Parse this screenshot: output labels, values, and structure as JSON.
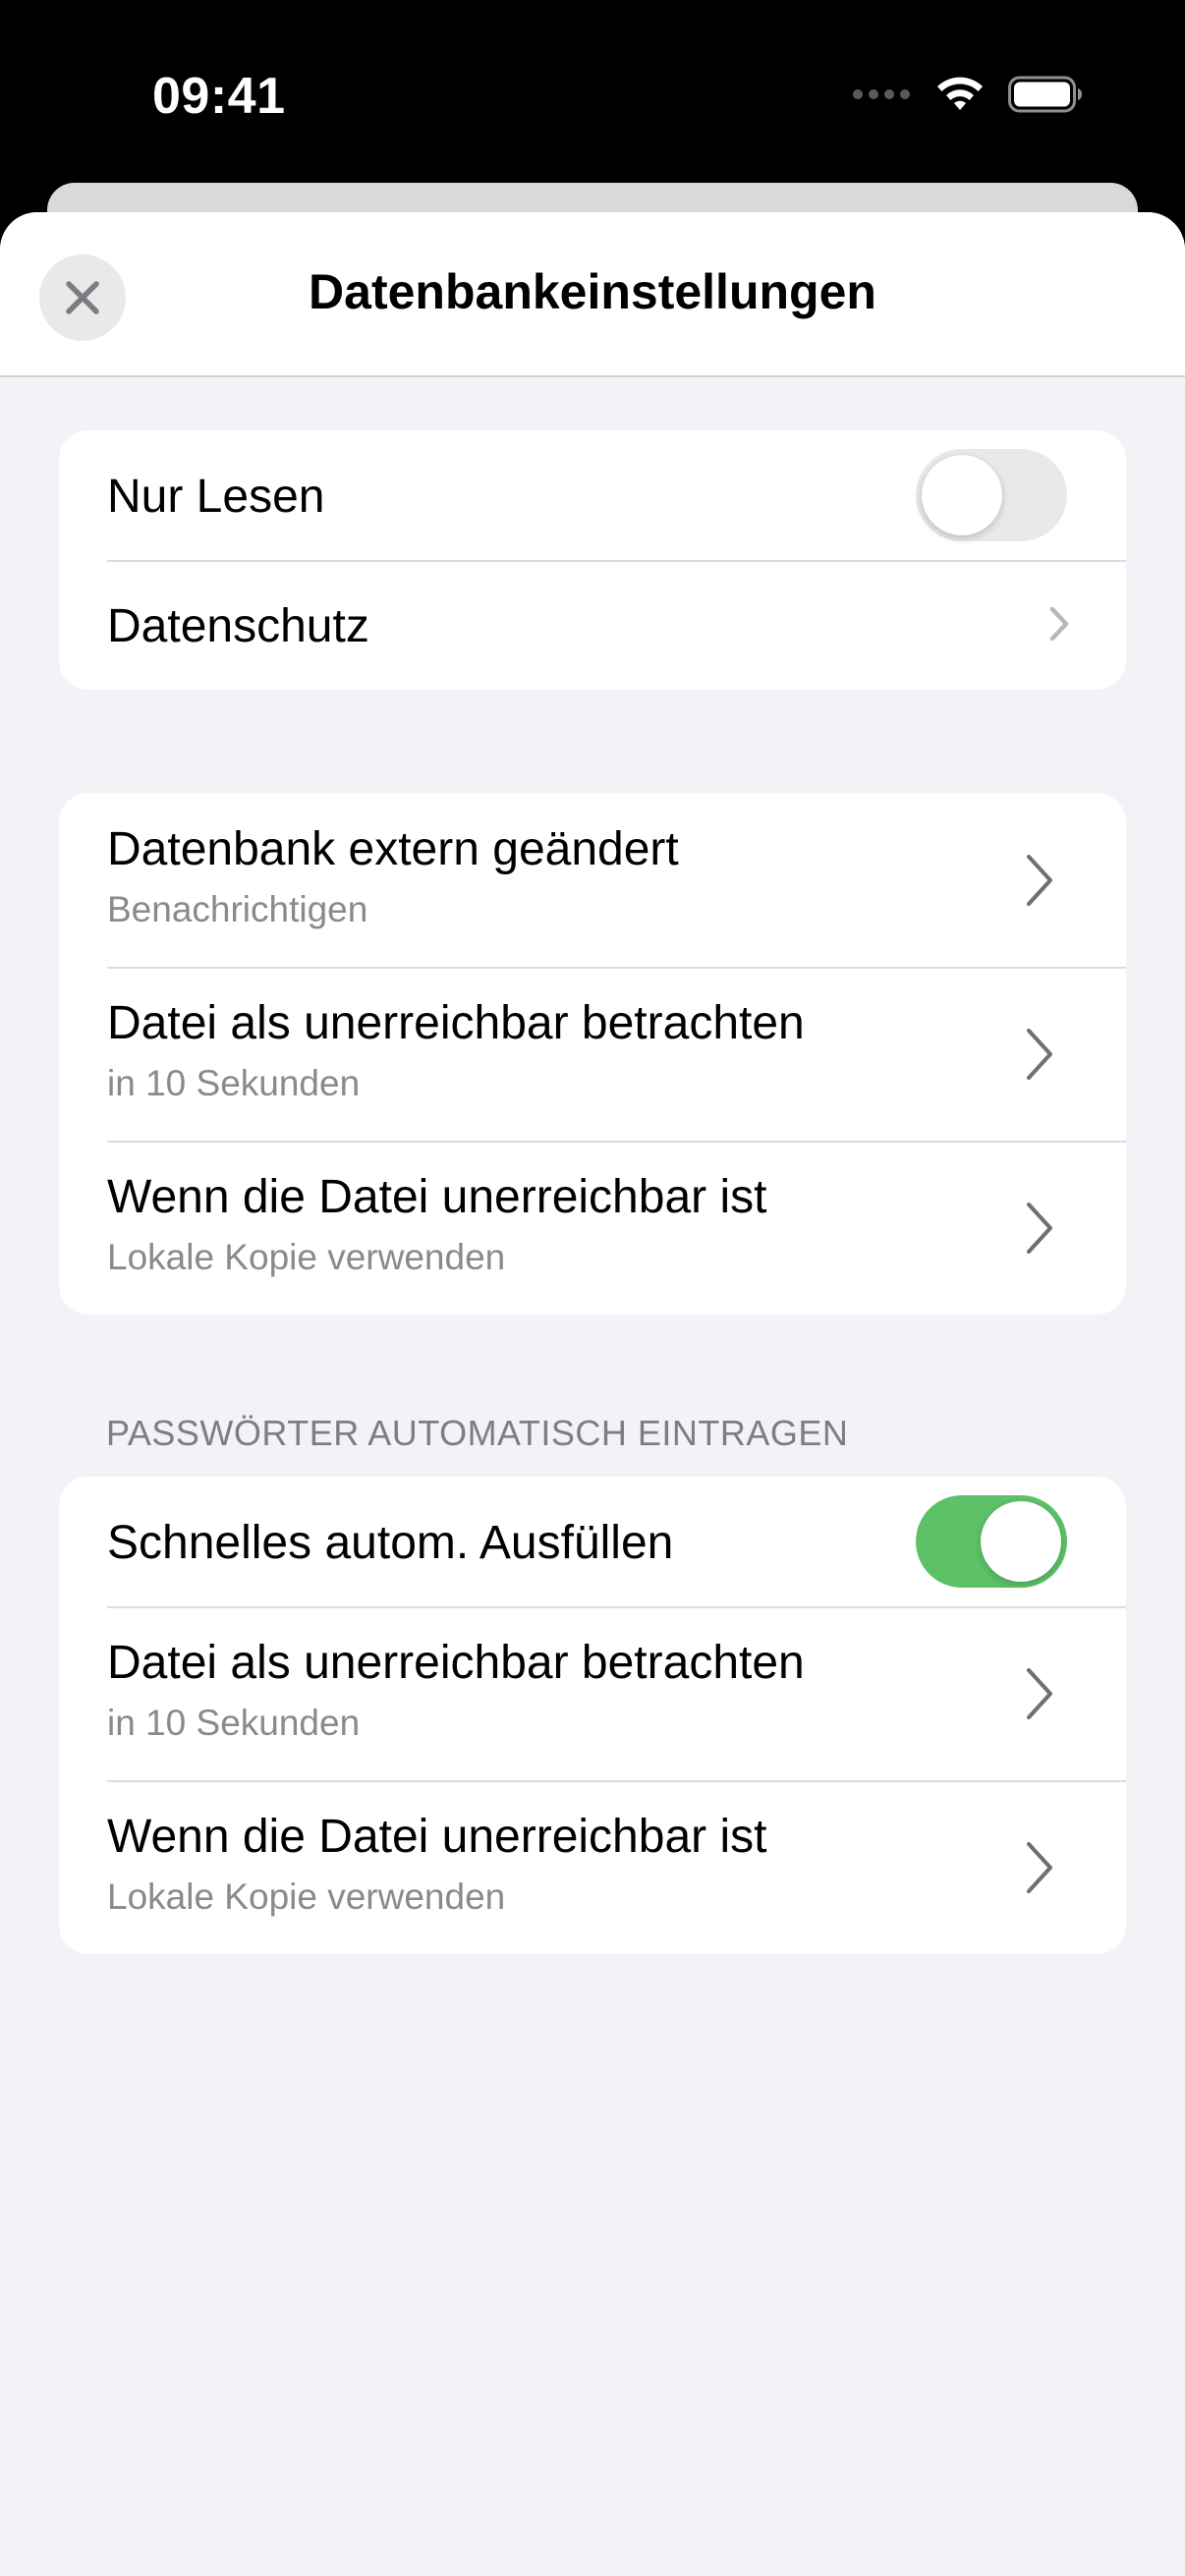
{
  "status": {
    "time": "09:41"
  },
  "nav": {
    "title": "Datenbankeinstellungen",
    "close_icon": "close-icon"
  },
  "group1": {
    "read_only": {
      "label": "Nur Lesen",
      "enabled": false
    },
    "privacy": {
      "label": "Datenschutz"
    }
  },
  "group2": {
    "rows": [
      {
        "title": "Datenbank extern geändert",
        "subtitle": "Benachrichtigen"
      },
      {
        "title": "Datei als unerreichbar betrachten",
        "subtitle": "in 10 Sekunden"
      },
      {
        "title": "Wenn die Datei unerreichbar ist",
        "subtitle": "Lokale Kopie verwenden"
      }
    ]
  },
  "autofill": {
    "header": "PASSWÖRTER AUTOMATISCH EINTRAGEN",
    "quick_autofill": {
      "label": "Schnelles autom. Ausfüllen",
      "enabled": true
    },
    "rows": [
      {
        "title": "Datei als unerreichbar betrachten",
        "subtitle": "in 10 Sekunden"
      },
      {
        "title": "Wenn die Datei unerreichbar ist",
        "subtitle": "Lokale Kopie verwenden"
      }
    ]
  },
  "colors": {
    "toggle_on": "#5dc167",
    "background": "#f2f2f7"
  }
}
